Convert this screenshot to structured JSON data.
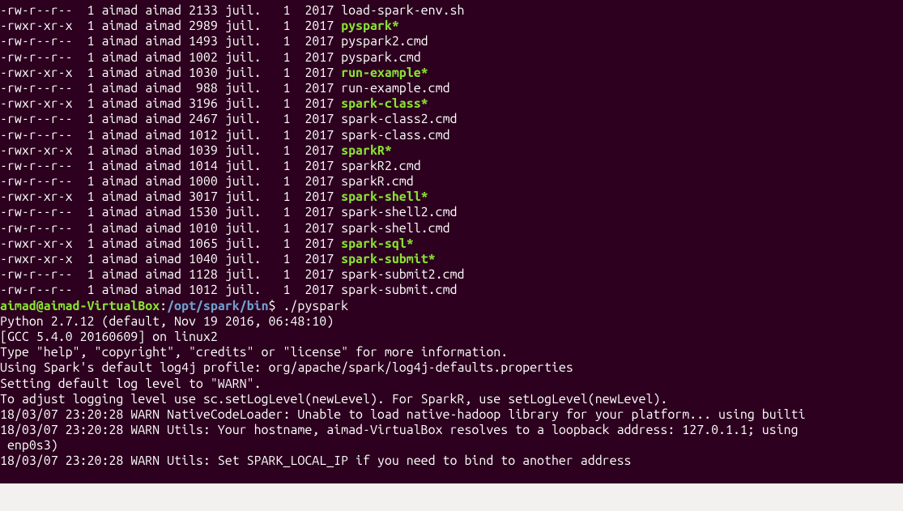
{
  "listing": [
    {
      "perms": "-rw-r--r--",
      "links": "1",
      "owner": "aimad",
      "group": "aimad",
      "size": "2133",
      "month": "juil.",
      "day": "1",
      "year": "2017",
      "name": "load-spark-env.sh",
      "exec": false
    },
    {
      "perms": "-rwxr-xr-x",
      "links": "1",
      "owner": "aimad",
      "group": "aimad",
      "size": "2989",
      "month": "juil.",
      "day": "1",
      "year": "2017",
      "name": "pyspark*",
      "exec": true
    },
    {
      "perms": "-rw-r--r--",
      "links": "1",
      "owner": "aimad",
      "group": "aimad",
      "size": "1493",
      "month": "juil.",
      "day": "1",
      "year": "2017",
      "name": "pyspark2.cmd",
      "exec": false
    },
    {
      "perms": "-rw-r--r--",
      "links": "1",
      "owner": "aimad",
      "group": "aimad",
      "size": "1002",
      "month": "juil.",
      "day": "1",
      "year": "2017",
      "name": "pyspark.cmd",
      "exec": false
    },
    {
      "perms": "-rwxr-xr-x",
      "links": "1",
      "owner": "aimad",
      "group": "aimad",
      "size": "1030",
      "month": "juil.",
      "day": "1",
      "year": "2017",
      "name": "run-example*",
      "exec": true
    },
    {
      "perms": "-rw-r--r--",
      "links": "1",
      "owner": "aimad",
      "group": "aimad",
      "size": " 988",
      "month": "juil.",
      "day": "1",
      "year": "2017",
      "name": "run-example.cmd",
      "exec": false
    },
    {
      "perms": "-rwxr-xr-x",
      "links": "1",
      "owner": "aimad",
      "group": "aimad",
      "size": "3196",
      "month": "juil.",
      "day": "1",
      "year": "2017",
      "name": "spark-class*",
      "exec": true
    },
    {
      "perms": "-rw-r--r--",
      "links": "1",
      "owner": "aimad",
      "group": "aimad",
      "size": "2467",
      "month": "juil.",
      "day": "1",
      "year": "2017",
      "name": "spark-class2.cmd",
      "exec": false
    },
    {
      "perms": "-rw-r--r--",
      "links": "1",
      "owner": "aimad",
      "group": "aimad",
      "size": "1012",
      "month": "juil.",
      "day": "1",
      "year": "2017",
      "name": "spark-class.cmd",
      "exec": false
    },
    {
      "perms": "-rwxr-xr-x",
      "links": "1",
      "owner": "aimad",
      "group": "aimad",
      "size": "1039",
      "month": "juil.",
      "day": "1",
      "year": "2017",
      "name": "sparkR*",
      "exec": true
    },
    {
      "perms": "-rw-r--r--",
      "links": "1",
      "owner": "aimad",
      "group": "aimad",
      "size": "1014",
      "month": "juil.",
      "day": "1",
      "year": "2017",
      "name": "sparkR2.cmd",
      "exec": false
    },
    {
      "perms": "-rw-r--r--",
      "links": "1",
      "owner": "aimad",
      "group": "aimad",
      "size": "1000",
      "month": "juil.",
      "day": "1",
      "year": "2017",
      "name": "sparkR.cmd",
      "exec": false
    },
    {
      "perms": "-rwxr-xr-x",
      "links": "1",
      "owner": "aimad",
      "group": "aimad",
      "size": "3017",
      "month": "juil.",
      "day": "1",
      "year": "2017",
      "name": "spark-shell*",
      "exec": true
    },
    {
      "perms": "-rw-r--r--",
      "links": "1",
      "owner": "aimad",
      "group": "aimad",
      "size": "1530",
      "month": "juil.",
      "day": "1",
      "year": "2017",
      "name": "spark-shell2.cmd",
      "exec": false
    },
    {
      "perms": "-rw-r--r--",
      "links": "1",
      "owner": "aimad",
      "group": "aimad",
      "size": "1010",
      "month": "juil.",
      "day": "1",
      "year": "2017",
      "name": "spark-shell.cmd",
      "exec": false
    },
    {
      "perms": "-rwxr-xr-x",
      "links": "1",
      "owner": "aimad",
      "group": "aimad",
      "size": "1065",
      "month": "juil.",
      "day": "1",
      "year": "2017",
      "name": "spark-sql*",
      "exec": true
    },
    {
      "perms": "-rwxr-xr-x",
      "links": "1",
      "owner": "aimad",
      "group": "aimad",
      "size": "1040",
      "month": "juil.",
      "day": "1",
      "year": "2017",
      "name": "spark-submit*",
      "exec": true
    },
    {
      "perms": "-rw-r--r--",
      "links": "1",
      "owner": "aimad",
      "group": "aimad",
      "size": "1128",
      "month": "juil.",
      "day": "1",
      "year": "2017",
      "name": "spark-submit2.cmd",
      "exec": false
    },
    {
      "perms": "-rw-r--r--",
      "links": "1",
      "owner": "aimad",
      "group": "aimad",
      "size": "1012",
      "month": "juil.",
      "day": "1",
      "year": "2017",
      "name": "spark-submit.cmd",
      "exec": false
    }
  ],
  "prompt": {
    "user": "aimad@aimad-VirtualBox",
    "sep1": ":",
    "path": "/opt/spark/bin",
    "sep2": "$ ",
    "command": "./pyspark"
  },
  "output": [
    "Python 2.7.12 (default, Nov 19 2016, 06:48:10)",
    "[GCC 5.4.0 20160609] on linux2",
    "Type \"help\", \"copyright\", \"credits\" or \"license\" for more information.",
    "Using Spark's default log4j profile: org/apache/spark/log4j-defaults.properties",
    "Setting default log level to \"WARN\".",
    "To adjust logging level use sc.setLogLevel(newLevel). For SparkR, use setLogLevel(newLevel).",
    "18/03/07 23:20:28 WARN NativeCodeLoader: Unable to load native-hadoop library for your platform... using builti",
    "18/03/07 23:20:28 WARN Utils: Your hostname, aimad-VirtualBox resolves to a loopback address: 127.0.1.1; using ",
    " enp0s3)",
    "18/03/07 23:20:28 WARN Utils: Set SPARK_LOCAL_IP if you need to bind to another address"
  ]
}
